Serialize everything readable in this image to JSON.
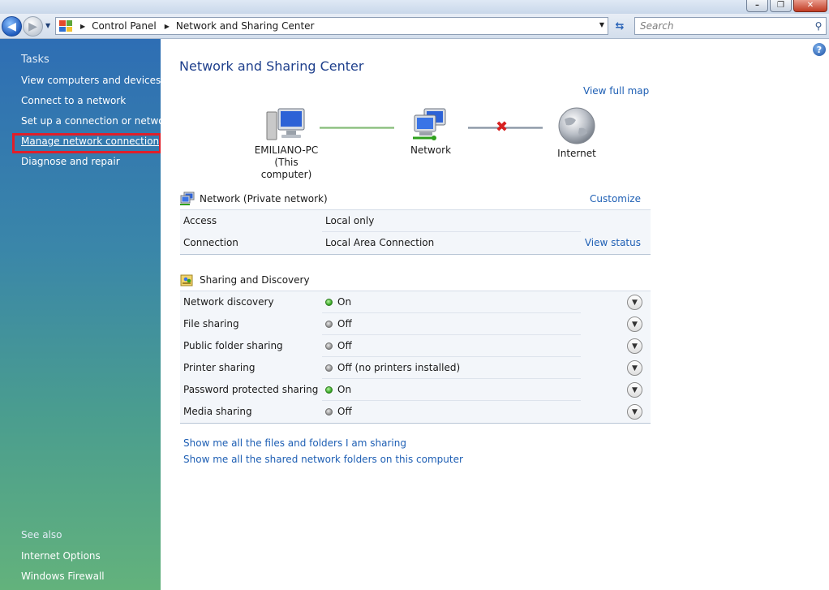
{
  "window": {
    "minimize": "–",
    "maximize": "❐",
    "close": "✕"
  },
  "address_bar": {
    "crumbs": [
      "Control Panel",
      "Network and Sharing Center"
    ],
    "search_placeholder": "Search"
  },
  "sidebar": {
    "tasks_heading": "Tasks",
    "tasks": [
      "View computers and devices",
      "Connect to a network",
      "Set up a connection or network",
      "Manage network connections",
      "Diagnose and repair"
    ],
    "see_also_heading": "See also",
    "see_also": [
      "Internet Options",
      "Windows Firewall"
    ]
  },
  "main": {
    "title": "Network and Sharing Center",
    "view_full_map": "View full map",
    "map": {
      "computer_name": "EMILIANO-PC",
      "computer_sub": "(This computer)",
      "network_label": "Network",
      "internet_label": "Internet"
    },
    "network_section": {
      "title": "Network (Private network)",
      "customize": "Customize",
      "rows": [
        {
          "key": "Access",
          "value": "Local only"
        },
        {
          "key": "Connection",
          "value": "Local Area Connection",
          "link": "View status"
        }
      ]
    },
    "sharing_section": {
      "title": "Sharing and Discovery",
      "rows": [
        {
          "key": "Network discovery",
          "value": "On",
          "status": "on"
        },
        {
          "key": "File sharing",
          "value": "Off",
          "status": "off"
        },
        {
          "key": "Public folder sharing",
          "value": "Off",
          "status": "off"
        },
        {
          "key": "Printer sharing",
          "value": "Off (no printers installed)",
          "status": "off"
        },
        {
          "key": "Password protected sharing",
          "value": "On",
          "status": "on"
        },
        {
          "key": "Media sharing",
          "value": "Off",
          "status": "off"
        }
      ]
    },
    "bottom_links": [
      "Show me all the files and folders I am sharing",
      "Show me all the shared network folders on this computer"
    ]
  },
  "colors": {
    "accent": "#1e5fb4",
    "highlight": "#e01f2a",
    "status_on": "#2ea01c",
    "status_off": "#8a8a8a"
  },
  "icons": [
    "back-arrow-icon",
    "forward-arrow-icon",
    "control-panel-icon",
    "refresh-icon",
    "search-icon",
    "help-icon",
    "computer-icon",
    "network-icon",
    "globe-icon",
    "disconnect-x-icon",
    "sharing-icon",
    "expand-chevron-icon"
  ]
}
